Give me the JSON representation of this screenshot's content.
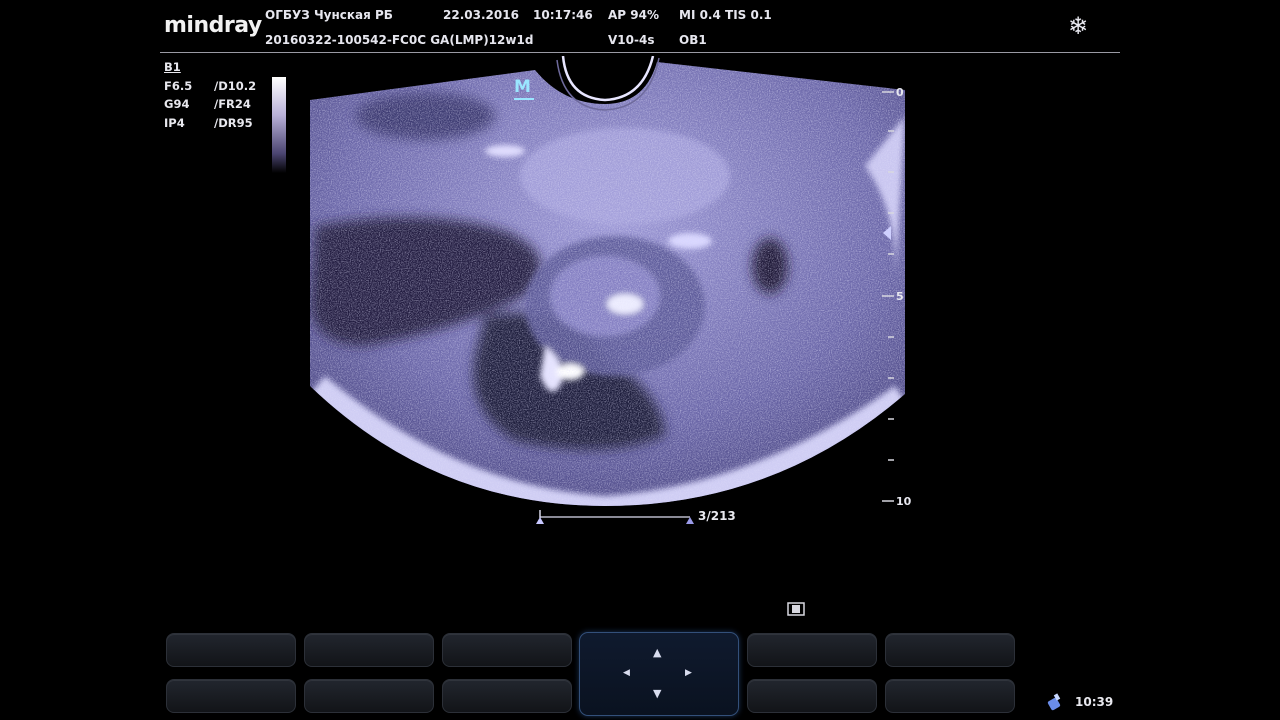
{
  "header": {
    "brand": "mindray",
    "hospital": "ОГБУЗ Чунская РБ",
    "patient_id": "20160322-100542-FC0C GA(LMP)12w1d",
    "date": "22.03.2016",
    "time": "10:17:46",
    "ap": "AP  94%",
    "probe": "V10-4s",
    "mi_tis": "MI 0.4  TIS 0.1",
    "exam": "OB1",
    "freeze_icon": "snowflake-icon"
  },
  "params": {
    "mode": "B1",
    "rows": [
      {
        "a": "F6.5",
        "b": "/D10.2"
      },
      {
        "a": "G94",
        "b": "/FR24"
      },
      {
        "a": "IP4",
        "b": "/DR95"
      }
    ]
  },
  "image": {
    "orientation_marker": "M",
    "depth_labels": [
      "0",
      "5",
      "10"
    ],
    "tint": "#8a86c8"
  },
  "cine": {
    "frame_counter": "3/213"
  },
  "softkeys": {
    "count_top": 5,
    "count_bottom": 5
  },
  "status": {
    "clock": "10:39"
  }
}
